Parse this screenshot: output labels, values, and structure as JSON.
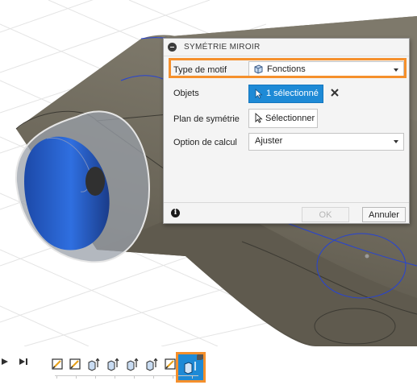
{
  "dialog": {
    "title": "SYMÉTRIE MIROIR",
    "rows": {
      "pattern_type": {
        "label": "Type de motif",
        "value": "Fonctions"
      },
      "objects": {
        "label": "Objets",
        "value": "1 sélectionné"
      },
      "mirror_plane": {
        "label": "Plan de symétrie",
        "value": "Sélectionner"
      },
      "compute_option": {
        "label": "Option de calcul",
        "value": "Ajuster"
      }
    },
    "footer": {
      "info_glyph": "i",
      "ok_label": "OK",
      "cancel_label": "Annuler"
    }
  },
  "timeline": {
    "feature_count": 8,
    "features": [
      "sketch",
      "sketch",
      "extrude",
      "extrude",
      "extrude",
      "extrude",
      "sketch",
      "mirror"
    ]
  },
  "colors": {
    "accent": "#1e8ad6",
    "highlight": "#f5902c",
    "body": "#6b6659",
    "selected_face": "#2b62d0"
  }
}
